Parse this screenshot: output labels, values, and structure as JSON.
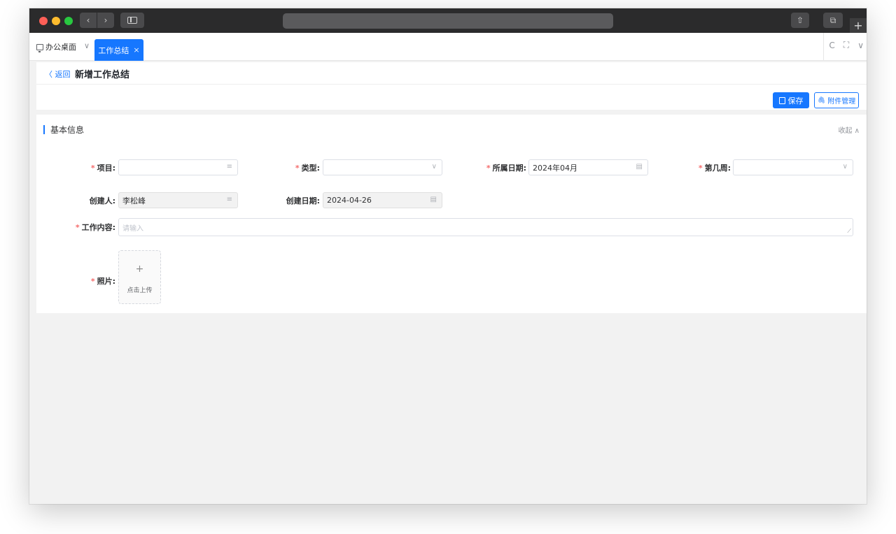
{
  "browser": {
    "nav_back": "‹",
    "nav_forward": "›",
    "share_icon": "⇧",
    "tabs_icon": "⧉",
    "new_tab": "+"
  },
  "tabs": {
    "desk": {
      "label": "办公桌面",
      "chevron": "∨"
    },
    "active": {
      "label": "工作总结",
      "close": "×"
    },
    "tools": {
      "refresh": "C",
      "fullscreen": "⛶",
      "more": "∨"
    }
  },
  "header": {
    "back": "〈 返回",
    "title": "新增工作总结",
    "save_label": "保存",
    "attach_label": "附件管理",
    "attach_icon": "🖇"
  },
  "section": {
    "title": "基本信息",
    "collapse_label": "收起 ∧"
  },
  "form": {
    "project": {
      "label": "项目:",
      "required": "*",
      "value": "",
      "suffix": "≡"
    },
    "type": {
      "label": "类型:",
      "required": "*",
      "value": "",
      "suffix": "∨"
    },
    "date": {
      "label": "所属日期:",
      "required": "*",
      "value": "2024年04月",
      "suffix": "▤"
    },
    "week": {
      "label": "第几周:",
      "required": "*",
      "value": "",
      "suffix": "∨"
    },
    "creator": {
      "label": "创建人:",
      "value": "李松峰",
      "suffix": "≡"
    },
    "created_date": {
      "label": "创建日期:",
      "value": "2024-04-26",
      "suffix": "▤"
    },
    "content": {
      "label": "工作内容:",
      "required": "*",
      "placeholder": "请输入",
      "resize": "⟋"
    },
    "photo": {
      "label": "照片:",
      "required": "*",
      "plus": "+",
      "upload_text": "点击上传"
    }
  },
  "colors": {
    "primary": "#1677ff",
    "required": "#f56c6c",
    "page_bg": "#f2f2f2"
  }
}
